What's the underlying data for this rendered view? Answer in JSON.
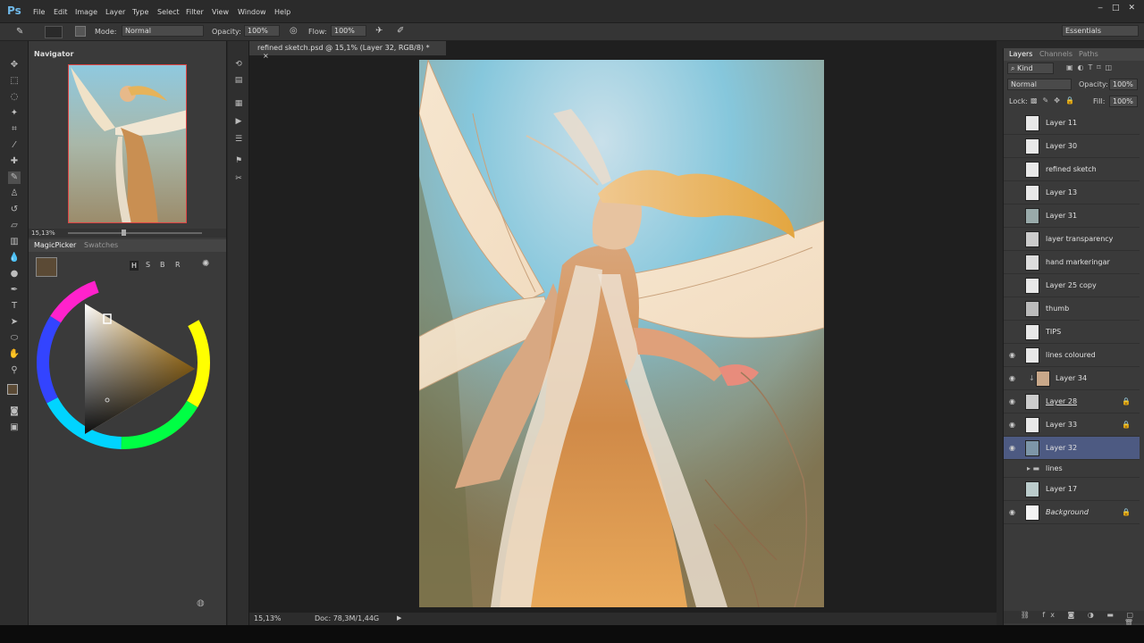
{
  "app": {
    "logo": "Ps"
  },
  "menubar": {
    "items": [
      "File",
      "Edit",
      "Image",
      "Layer",
      "Type",
      "Select",
      "Filter",
      "View",
      "Window",
      "Help"
    ],
    "workspace": "Essentials",
    "window_controls": [
      "‒",
      "□",
      "✕"
    ]
  },
  "options_bar": {
    "mode_label": "Mode:",
    "mode_value": "Normal",
    "opacity_label": "Opacity:",
    "opacity_value": "100%",
    "flow_label": "Flow:",
    "flow_value": "100%"
  },
  "document": {
    "tab_title": "refined sketch.psd @ 15,1% (Layer 32, RGB/8) *",
    "close": "×"
  },
  "navigator": {
    "title": "Navigator",
    "zoom": "15,13%"
  },
  "color_panel": {
    "tabs": [
      "MagicPicker",
      "Swatches"
    ],
    "buttons": [
      "H",
      "S",
      "B",
      "R"
    ],
    "foreground_color": "#5b4a35"
  },
  "status": {
    "zoom": "15,13%",
    "doc_info": "Doc: 78,3M/1,44G"
  },
  "layers_panel": {
    "tabs": [
      "Layers",
      "Channels",
      "Paths"
    ],
    "filter_kind": "Kind",
    "blend_mode": "Normal",
    "opacity_label": "Opacity:",
    "opacity_value": "100%",
    "lock_label": "Lock:",
    "fill_label": "Fill:",
    "fill_value": "100%",
    "layers": [
      {
        "name": "Layer 11",
        "visible": false
      },
      {
        "name": "Layer 30",
        "visible": false
      },
      {
        "name": "refined sketch",
        "visible": false
      },
      {
        "name": "Layer 13",
        "visible": false
      },
      {
        "name": "Layer 31",
        "visible": false
      },
      {
        "name": "layer transparency",
        "visible": false
      },
      {
        "name": "hand markeringar",
        "visible": false
      },
      {
        "name": "Layer 25 copy",
        "visible": false
      },
      {
        "name": "thumb",
        "visible": false
      },
      {
        "name": "TIPS",
        "visible": false
      },
      {
        "name": "lines coloured",
        "visible": true
      },
      {
        "name": "Layer 34",
        "visible": true
      },
      {
        "name": "Layer 28",
        "visible": true
      },
      {
        "name": "Layer 33",
        "visible": true
      },
      {
        "name": "Layer 32",
        "visible": true
      },
      {
        "name": "lines",
        "visible": false
      },
      {
        "name": "Layer 17",
        "visible": false
      },
      {
        "name": "Background",
        "visible": true
      }
    ]
  },
  "icons": {
    "eye": "◉",
    "lock": "🔒",
    "folder": "▸"
  }
}
